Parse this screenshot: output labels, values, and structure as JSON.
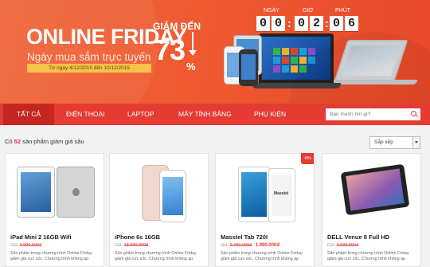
{
  "banner": {
    "title": "ONLINE FRIDAY",
    "subtitle": "Ngày mua sắm trực tuyến",
    "date_range": "Từ ngày 4/12/2015 đến 10/12/2015",
    "discount_label": "GIẢM ĐẾN",
    "discount_value": "73",
    "discount_unit": "%",
    "countdown": {
      "day_label": "NGÀY",
      "hour_label": "GIỜ",
      "minute_label": "PHÚT",
      "d1": "0",
      "d2": "0",
      "h1": "0",
      "h2": "2",
      "m1": "0",
      "m2": "6",
      "sep": ":"
    }
  },
  "nav": {
    "items": [
      {
        "label": "TẤT CẢ"
      },
      {
        "label": "ĐIỆN THOẠI"
      },
      {
        "label": "LAPTOP"
      },
      {
        "label": "MÁY TÍNH BẢNG"
      },
      {
        "label": "PHỤ KIỆN"
      }
    ],
    "active_index": 0,
    "search_placeholder": "Bạn muốn tìm gì?"
  },
  "results": {
    "prefix": "Có ",
    "count": "52",
    "suffix": " sản phẩm giảm giá sâu",
    "sort_label": "Sắp xếp"
  },
  "products": [
    {
      "name": "iPad Mini 2 16GB Wifi",
      "price_prefix": "Giá:",
      "price_old": "6.990.000đ",
      "price_new": "",
      "desc": "Sản phẩm trong chương trình Online Friday giảm giá cực sốc. Chương trình không áp"
    },
    {
      "name": "iPhone 6s 16GB",
      "price_prefix": "Giá:",
      "price_old": "18.990.000đ",
      "price_new": "",
      "desc": "Sản phẩm trong chương trình Online Friday giảm giá cực sốc. Chương trình không áp"
    },
    {
      "name": "Masstel Tab 720I",
      "price_prefix": "Giá:",
      "price_old": "2.490.000đ",
      "price_new": "1.990.000đ",
      "badge": "-8%",
      "desc": "Sản phẩm trong chương trình Online Friday giảm giá cực sốc. Chương trình không áp"
    },
    {
      "name": "DELL Venue 8 Full HD",
      "price_prefix": "Giá:",
      "price_old": "3.990.000đ",
      "price_new": "",
      "desc": "Sản phẩm trong chương trình Online Friday giảm giá cực sốc. Chương trình không áp"
    }
  ],
  "colors": {
    "brand_red": "#e53b33",
    "banner_orange": "#ef5a31",
    "active_tab": "#c52720"
  }
}
